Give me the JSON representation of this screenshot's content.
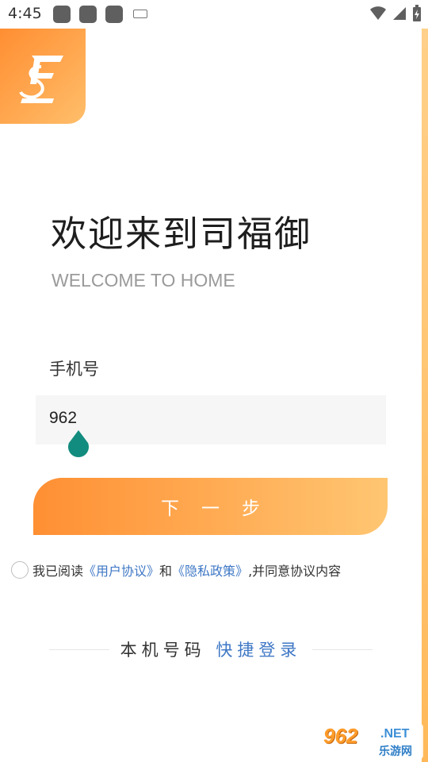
{
  "status_bar": {
    "time": "4:45"
  },
  "welcome": {
    "title": "欢迎来到司福御",
    "subtitle": "WELCOME TO HOME"
  },
  "phone": {
    "label": "手机号",
    "value": "962"
  },
  "next_button": {
    "label": "下一步"
  },
  "agreement": {
    "prefix": "我已阅读",
    "user_agreement": "《用户协议》",
    "and": "和",
    "privacy_policy": "《隐私政策》",
    "suffix": ",并同意协议内容"
  },
  "quick_login": {
    "plain": "本机号码",
    "link": "快捷登录"
  },
  "watermark": {
    "num": "962",
    "net": ".NET",
    "cn": "乐游网"
  },
  "colors": {
    "accent_start": "#ff8f33",
    "accent_end": "#ffc672",
    "link": "#3f78c5",
    "cursor": "#128c7e"
  }
}
